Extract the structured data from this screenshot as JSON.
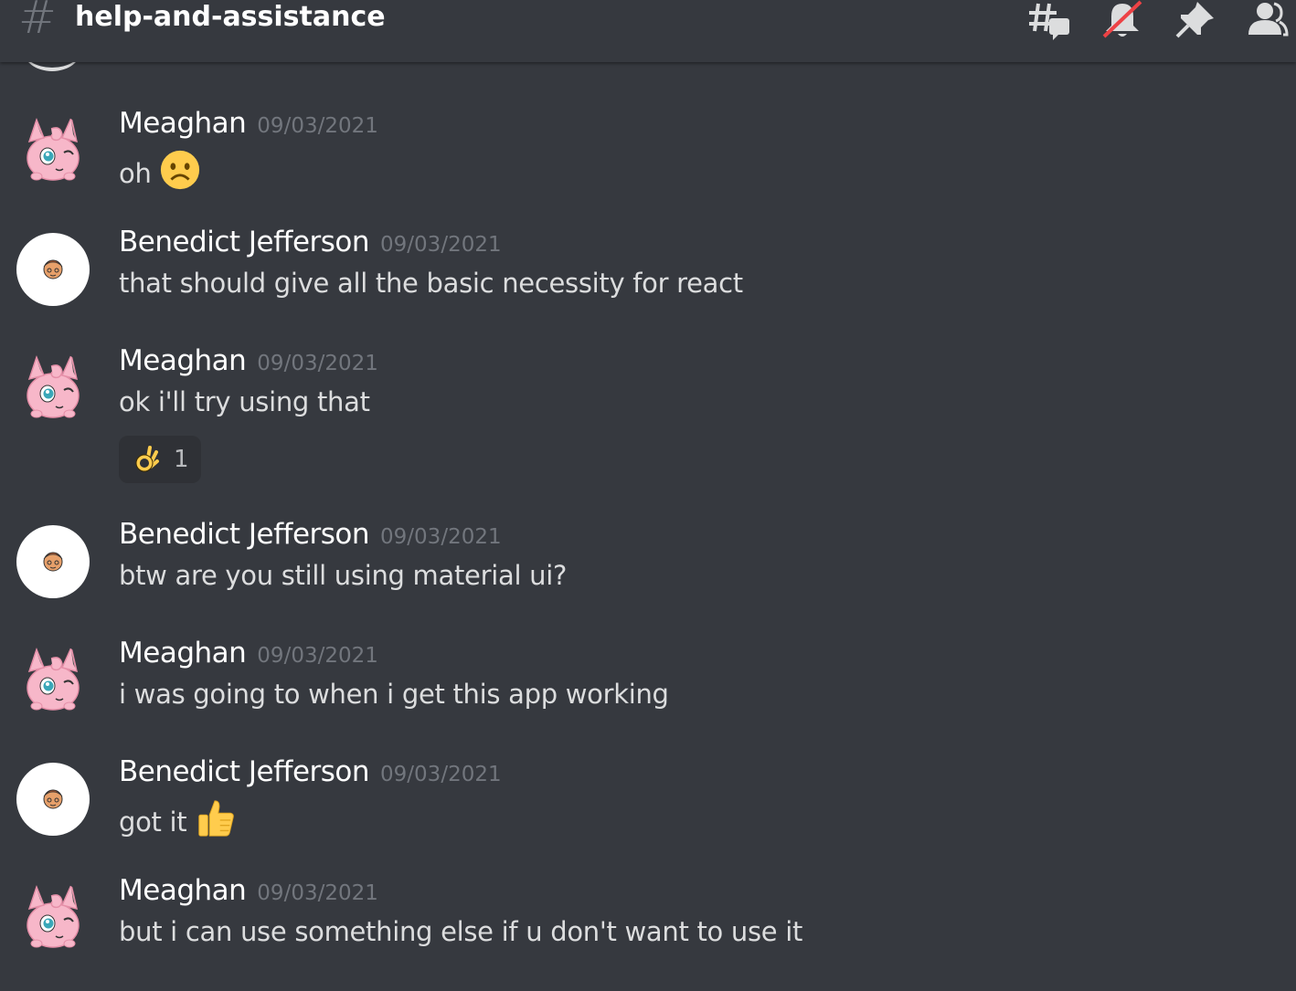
{
  "channel": {
    "name": "help-and-assistance",
    "hash_symbol": "#"
  },
  "header_icons": [
    "threads-icon",
    "mute-notifications-icon",
    "pinned-messages-icon",
    "member-list-icon"
  ],
  "messages": [
    {
      "author": "Meaghan",
      "timestamp": "09/03/2021",
      "text": "oh",
      "emoji": "frowning-face-emoji",
      "avatar": "jigglypuff-avatar"
    },
    {
      "author": "Benedict Jefferson",
      "timestamp": "09/03/2021",
      "text": "that should give all the basic necessity for react",
      "avatar": "cartoon-face-avatar"
    },
    {
      "author": "Meaghan",
      "timestamp": "09/03/2021",
      "text": "ok i'll try using that",
      "avatar": "jigglypuff-avatar",
      "reaction": {
        "emoji": "ok-hand-emoji",
        "count": "1"
      }
    },
    {
      "author": "Benedict Jefferson",
      "timestamp": "09/03/2021",
      "text": "btw are you still using material ui?",
      "avatar": "cartoon-face-avatar"
    },
    {
      "author": "Meaghan",
      "timestamp": "09/03/2021",
      "text": "i was going to when i get this app working",
      "avatar": "jigglypuff-avatar"
    },
    {
      "author": "Benedict Jefferson",
      "timestamp": "09/03/2021",
      "text": "got it",
      "emoji": "thumbs-up-emoji",
      "avatar": "cartoon-face-avatar"
    },
    {
      "author": "Meaghan",
      "timestamp": "09/03/2021",
      "text": "but i can use something else if u don't want to use it",
      "avatar": "jigglypuff-avatar"
    }
  ],
  "colors": {
    "background": "#36393f",
    "header_icon": "#dcddde",
    "timestamp": "#72767d",
    "author": "#ffffff",
    "message_text": "#dcddde",
    "mute_slash": "#ed4245"
  }
}
